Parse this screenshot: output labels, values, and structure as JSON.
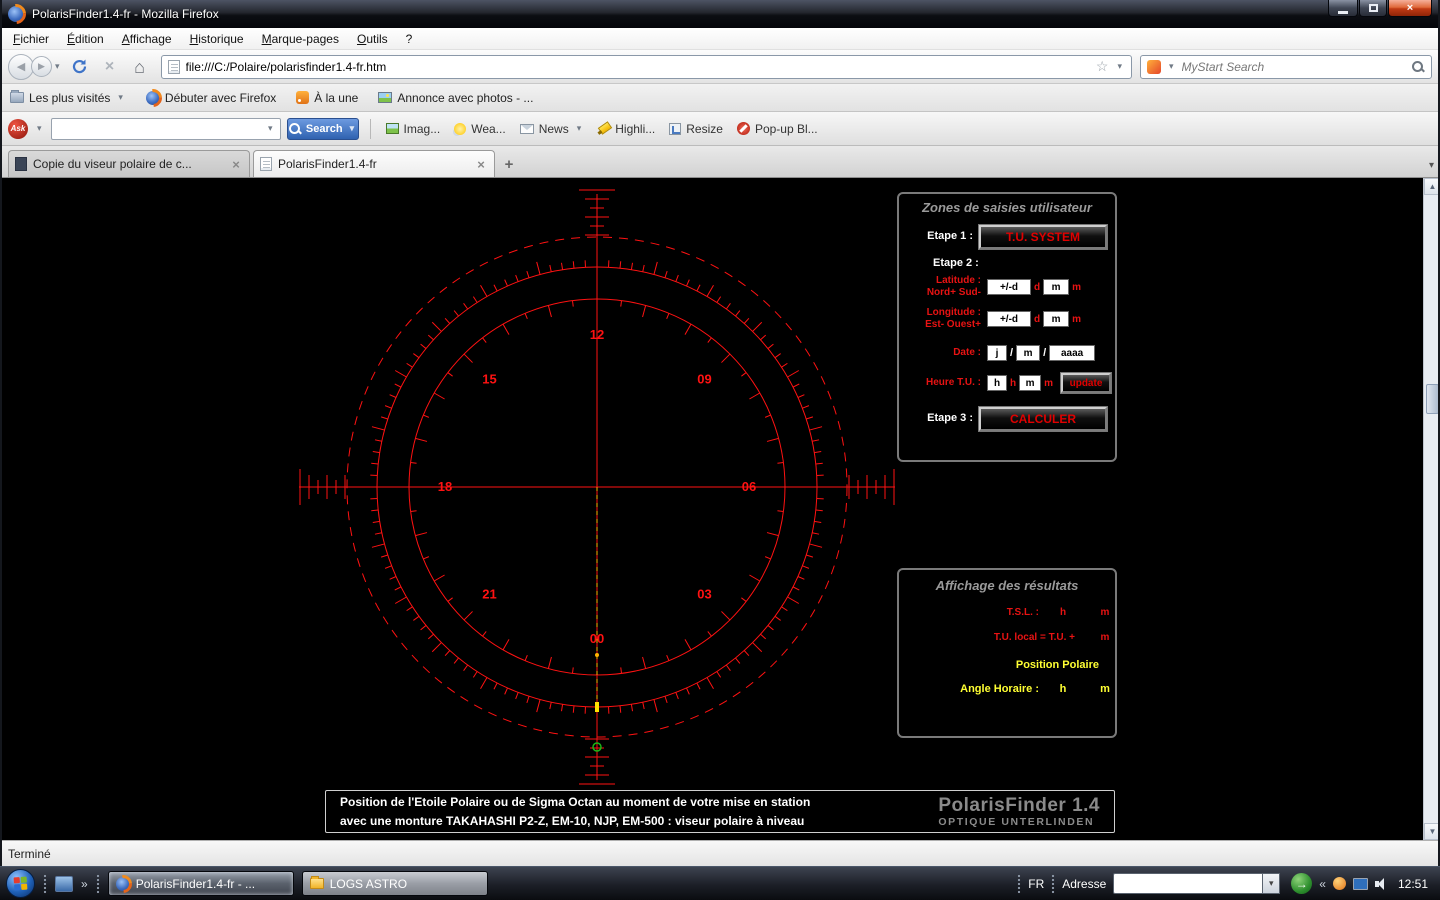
{
  "window": {
    "title": "PolarisFinder1.4-fr - Mozilla Firefox"
  },
  "icons": {
    "close_x": "×",
    "back_arrow": "◀",
    "forward_arrow": "▶",
    "caret_down": "▾",
    "star_outline": "☆",
    "home": "⌂",
    "stop_x": "×",
    "tab_close": "×",
    "new_tab_plus": "+",
    "overflow_right": "»",
    "collapse_left": "«",
    "go_arrow": "→",
    "scroll_up": "▲",
    "scroll_down": "▼"
  },
  "menu": {
    "items": [
      "Fichier",
      "Édition",
      "Affichage",
      "Historique",
      "Marque-pages",
      "Outils",
      "?"
    ]
  },
  "navbar": {
    "url": "file:///C:/Polaire/polarisfinder1.4-fr.htm",
    "search_text": "MyStart Search"
  },
  "bookmarks_bar": {
    "items": [
      "Les plus visités",
      "Débuter avec Firefox",
      "À la une",
      "Annonce avec photos - ..."
    ]
  },
  "ask_toolbar": {
    "logo": "Ask",
    "search_button": "Search",
    "buttons": [
      "Imag...",
      "Wea...",
      "News",
      "Highli...",
      "Resize",
      "Pop-up Bl..."
    ]
  },
  "tabs": {
    "items": [
      {
        "label": "Copie du viseur polaire de c...",
        "active": false
      },
      {
        "label": "PolarisFinder1.4-fr",
        "active": true
      }
    ]
  },
  "reticle": {
    "color": "#ff1212",
    "polaris_color": "#ffb400",
    "marker_color": "#ffe200",
    "octans_color": "#18b818",
    "hour_labels": [
      {
        "text": "12",
        "angle": 0
      },
      {
        "text": "09",
        "angle": 45
      },
      {
        "text": "06",
        "angle": 90
      },
      {
        "text": "03",
        "angle": 135
      },
      {
        "text": "00",
        "angle": 180
      },
      {
        "text": "21",
        "angle": 225
      },
      {
        "text": "18",
        "angle": 270
      },
      {
        "text": "15",
        "angle": 315
      }
    ]
  },
  "input_panel": {
    "title": "Zones de saisies utilisateur",
    "step1_label": "Etape 1 :",
    "tu_system_button": "T.U. SYSTEM",
    "step2_label": "Etape 2 :",
    "latitude_label": "Latitude :",
    "latitude_sub": "Nord+ Sud-",
    "longitude_label": "Longitude :",
    "longitude_sub": "Est- Ouest+",
    "deg_value": "+/-d",
    "deg_unit": "d",
    "min_value": "m",
    "min_unit": "m",
    "date_label": "Date :",
    "date_day": "j",
    "date_sep": "/",
    "date_month": "m",
    "date_year": "aaaa",
    "time_label": "Heure T.U. :",
    "hour_value": "h",
    "hour_unit": "h",
    "update_button": "update",
    "step3_label": "Etape 3 :",
    "calc_button": "CALCULER"
  },
  "results_panel": {
    "title": "Affichage des résultats",
    "tsl_label": "T.S.L. :",
    "tsl_h": "h",
    "tsl_m": "m",
    "tu_label": "T.U. local = T.U. +",
    "tu_m": "m",
    "position_label": "Position Polaire",
    "angle_label": "Angle Horaire :",
    "angle_h": "h",
    "angle_m": "m"
  },
  "footer": {
    "line1": "Position de l'Etoile Polaire ou de Sigma Octan au moment de votre mise en station",
    "line2": "avec une monture TAKAHASHI P2-Z, EM-10, NJP, EM-500 : viseur polaire à niveau",
    "brand": "PolarisFinder 1.4",
    "brand_sub": "OPTIQUE UNTERLINDEN"
  },
  "status_bar": {
    "text": "Terminé"
  },
  "taskbar": {
    "tasks": [
      {
        "label": "PolarisFinder1.4-fr - ..."
      },
      {
        "label": "LOGS ASTRO"
      }
    ],
    "language": "FR",
    "address_label": "Adresse",
    "clock": "12:51"
  }
}
